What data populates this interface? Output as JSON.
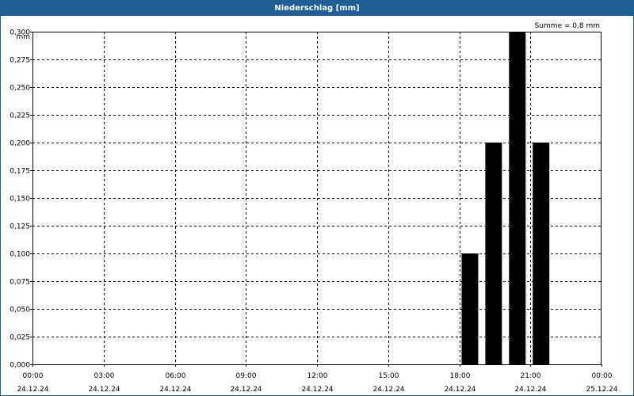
{
  "window": {
    "title": "Niederschlag [mm]"
  },
  "chart_data": {
    "type": "bar",
    "title": "Niederschlag [mm]",
    "ylabel": "mm",
    "xlabel": "",
    "summary": "Summe = 0,8 mm",
    "ylim": [
      0,
      0.3
    ],
    "yticks": [
      "0,000",
      "0,025",
      "0,050",
      "0,075",
      "0,100",
      "0,125",
      "0,150",
      "0,175",
      "0,200",
      "0,225",
      "0,250",
      "0,275",
      "0,300"
    ],
    "xlim_hours": [
      0,
      24
    ],
    "xticks": [
      {
        "time": "00:00",
        "date": "24.12.24",
        "hour": 0
      },
      {
        "time": "03:00",
        "date": "24.12.24",
        "hour": 3
      },
      {
        "time": "06:00",
        "date": "24.12.24",
        "hour": 6
      },
      {
        "time": "09:00",
        "date": "24.12.24",
        "hour": 9
      },
      {
        "time": "12:00",
        "date": "24.12.24",
        "hour": 12
      },
      {
        "time": "15:00",
        "date": "24.12.24",
        "hour": 15
      },
      {
        "time": "18:00",
        "date": "24.12.24",
        "hour": 18
      },
      {
        "time": "21:00",
        "date": "24.12.24",
        "hour": 21
      },
      {
        "time": "00:00",
        "date": "25.12.24",
        "hour": 24
      }
    ],
    "bars": [
      {
        "start_hour": 18,
        "end_hour": 19,
        "value": 0.1
      },
      {
        "start_hour": 19,
        "end_hour": 20,
        "value": 0.2
      },
      {
        "start_hour": 20,
        "end_hour": 21,
        "value": 0.3
      },
      {
        "start_hour": 21,
        "end_hour": 22,
        "value": 0.2
      }
    ],
    "bar_color": "#000000",
    "grid": true,
    "grid_style": "dashed"
  }
}
